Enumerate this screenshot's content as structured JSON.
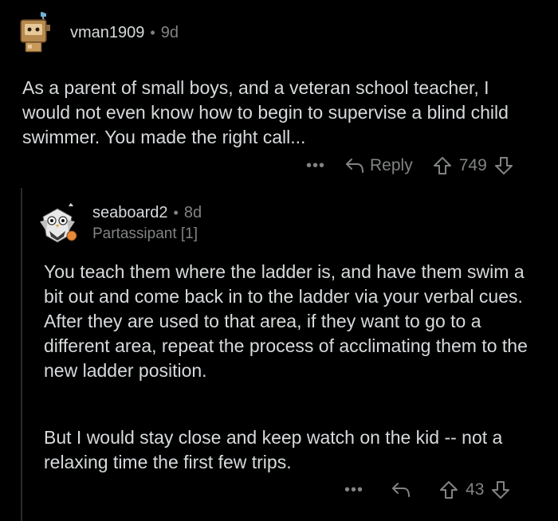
{
  "comments": [
    {
      "username": "vman1909",
      "separator": "•",
      "age": "9d",
      "avatar_icon": "robot-avatar-icon",
      "body": [
        "As a parent of small boys, and a veteran school teacher, I would not even know how to begin to supervise a blind child swimmer. You made the right call..."
      ],
      "actions": {
        "more": "•••",
        "reply_label": "Reply",
        "score": "749"
      }
    },
    {
      "username": "seaboard2",
      "separator": "•",
      "age": "8d",
      "flair": "Partassipant [1]",
      "avatar_icon": "owl-avatar-icon",
      "body": [
        "You teach them where the ladder is, and have them swim a bit out and come back in to the ladder via your verbal cues. After they are used to that area, if they want to go to a different area, repeat the process of acclimating them to the new ladder position.",
        "But I would stay close and keep watch on the kid -- not a relaxing time the first few trips."
      ],
      "actions": {
        "more": "•••",
        "score": "43"
      }
    }
  ],
  "colors": {
    "background": "#000000",
    "text": "#d7dadc",
    "muted": "#818384",
    "thread_line": "#2a2a2b"
  }
}
